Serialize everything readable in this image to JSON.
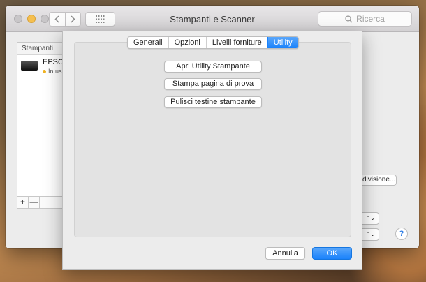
{
  "window": {
    "title": "Stampanti e Scanner",
    "search_placeholder": "Ricerca"
  },
  "printer_list": {
    "header": "Stampanti",
    "items": [
      {
        "name": "EPSO",
        "status": "In us"
      }
    ],
    "add_label": "+",
    "remove_label": "—"
  },
  "background": {
    "sharing_button": "divisione..."
  },
  "sheet": {
    "tabs": [
      {
        "label": "Generali",
        "active": false
      },
      {
        "label": "Opzioni",
        "active": false
      },
      {
        "label": "Livelli forniture",
        "active": false
      },
      {
        "label": "Utility",
        "active": true
      }
    ],
    "actions": {
      "open_utility": "Apri Utility Stampante",
      "print_test": "Stampa pagina di prova",
      "clean_heads": "Pulisci testine stampante"
    },
    "cancel_label": "Annulla",
    "ok_label": "OK"
  },
  "colors": {
    "accent": "#1a82fb",
    "status_dot": "#f0b323"
  }
}
